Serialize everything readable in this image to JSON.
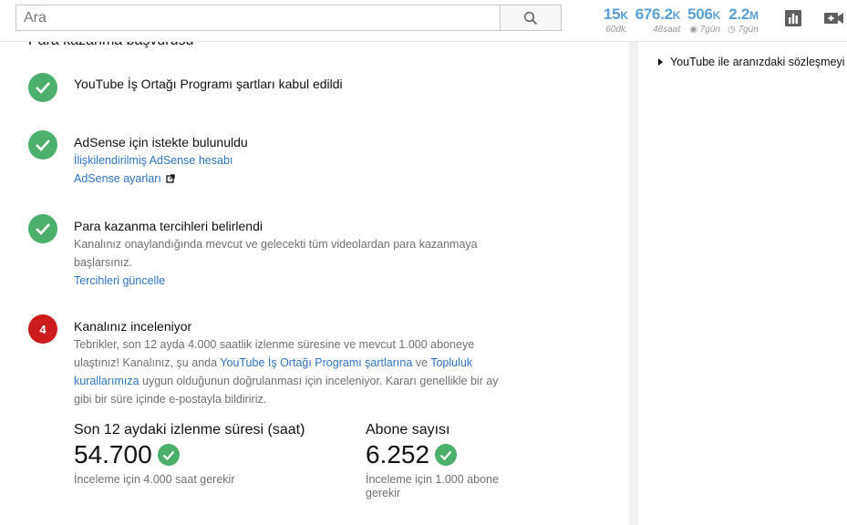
{
  "search": {
    "placeholder": "Ara"
  },
  "stats": [
    {
      "value": "15",
      "unit": "K",
      "sub": "60dk."
    },
    {
      "value": "676.2",
      "unit": "K",
      "sub": "48saat"
    },
    {
      "value": "506",
      "unit": "K",
      "sub": "7gün",
      "sub_icon": "eye-icon"
    },
    {
      "value": "2.2",
      "unit": "M",
      "sub": "7gün",
      "sub_icon": "clock-icon"
    }
  ],
  "section": {
    "title": "Para kazanma başvurusu"
  },
  "steps": [
    {
      "status": "done",
      "title": "YouTube İş Ortağı Programı şartları kabul edildi"
    },
    {
      "status": "done",
      "title": "AdSense için istekte bulunuldu",
      "links": [
        "İlişkilendirilmiş AdSense hesabı",
        "AdSense ayarları"
      ]
    },
    {
      "status": "done",
      "title": "Para kazanma tercihleri belirlendi",
      "description": "Kanalınız onaylandığında mevcut ve gelecekti tüm videolardan para kazanmaya başlarsınız.",
      "link": "Tercihleri güncelle"
    },
    {
      "status": "pending",
      "number": "4",
      "title": "Kanalınız inceleniyor",
      "description_part1": "Tebrikler, son 12 ayda 4.000 saatlik izlenme süresine ve mevcut 1.000 aboneye ulaştınız! Kanalınız, şu anda ",
      "link1": "YouTube İş Ortağı Programı şartlarına",
      "description_part2": " ve ",
      "link2": "Topluluk kurallarımıza",
      "description_part3": " uygun olduğunun doğrulanması için inceleniyor. Kararı genellikle bir ay gibi bir süre içinde e-postayla bildiririz."
    }
  ],
  "metrics": [
    {
      "label": "Son 12 aydaki izlenme süresi (saat)",
      "value": "54.700",
      "note": "İnceleme için 4.000 saat gerekir"
    },
    {
      "label": "Abone sayısı",
      "value": "6.252",
      "note": "İnceleme için 1.000 abone gerekir"
    }
  ],
  "right_panel": {
    "item": "YouTube ile aranızdaki sözleşmeyi"
  },
  "colors": {
    "accent_green": "#4caf6e",
    "accent_red": "#cc1c1c",
    "link_blue": "#2f73c2",
    "stat_blue": "#5b9fd8"
  }
}
